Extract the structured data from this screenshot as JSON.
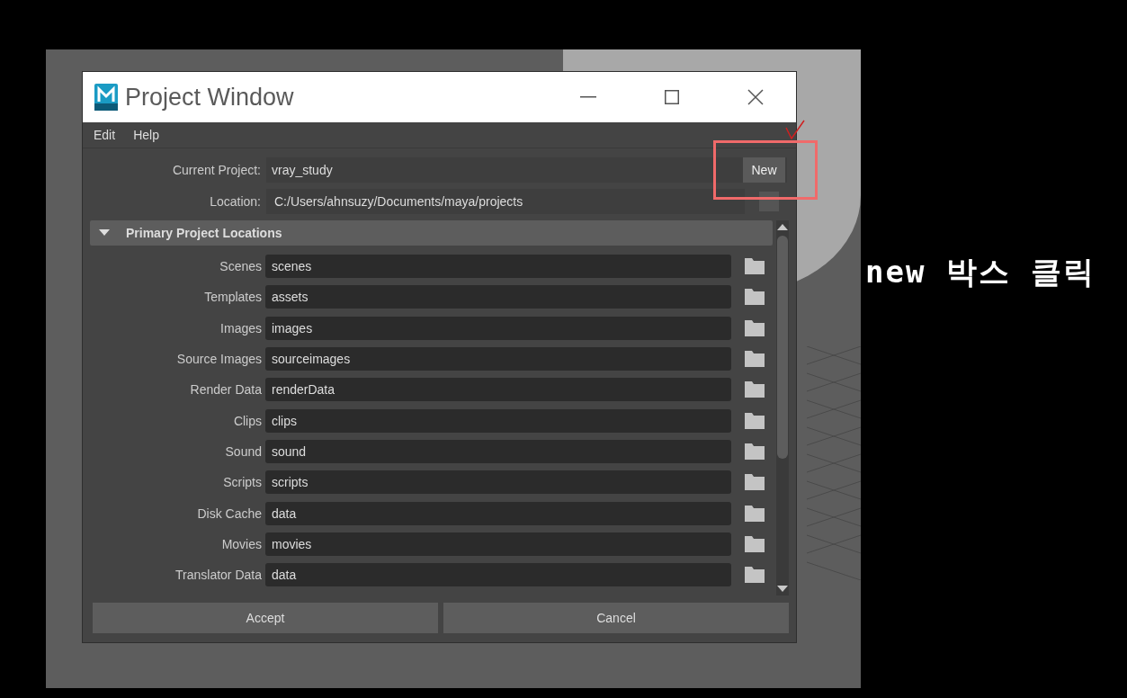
{
  "window": {
    "title": "Project Window"
  },
  "menu": [
    "Edit",
    "Help"
  ],
  "current_project": {
    "label": "Current Project:",
    "value": "vray_study",
    "button": "New"
  },
  "location": {
    "label": "Location:",
    "value": "C:/Users/ahnsuzy/Documents/maya/projects"
  },
  "section": {
    "title": "Primary Project Locations",
    "expanded": true
  },
  "locations": [
    {
      "label": "Scenes",
      "value": "scenes"
    },
    {
      "label": "Templates",
      "value": "assets"
    },
    {
      "label": "Images",
      "value": "images"
    },
    {
      "label": "Source Images",
      "value": "sourceimages"
    },
    {
      "label": "Render Data",
      "value": "renderData"
    },
    {
      "label": "Clips",
      "value": "clips"
    },
    {
      "label": "Sound",
      "value": "sound"
    },
    {
      "label": "Scripts",
      "value": "scripts"
    },
    {
      "label": "Disk Cache",
      "value": "data"
    },
    {
      "label": "Movies",
      "value": "movies"
    },
    {
      "label": "Translator Data",
      "value": "data"
    }
  ],
  "buttons": [
    "Accept",
    "Cancel"
  ],
  "annotation": {
    "text": "new 박스 클릭"
  }
}
